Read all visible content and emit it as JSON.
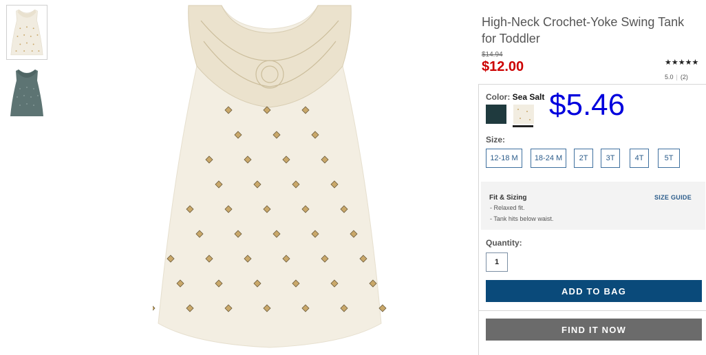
{
  "product": {
    "title": "High-Neck Crochet-Yoke Swing Tank for Toddler",
    "original_price": "$14.94",
    "sale_price": "$12.00",
    "stars": "★★★★★",
    "rating_value": "5.0",
    "rating_count": "(2)"
  },
  "color": {
    "label": "Color:",
    "selected": "Sea Salt",
    "swatches": [
      {
        "name": "dark-teal",
        "hex": "#1f3a3e"
      },
      {
        "name": "sea-salt",
        "hex": "#f2ede1"
      }
    ]
  },
  "overlay_price": "$5.46",
  "size": {
    "label": "Size:",
    "options": [
      "12-18 M",
      "18-24 M",
      "2T",
      "3T",
      "4T",
      "5T"
    ]
  },
  "fit": {
    "title": "Fit & Sizing",
    "size_guide": "SIZE GUIDE",
    "lines": [
      "- Relaxed fit.",
      "- Tank hits below waist."
    ]
  },
  "quantity": {
    "label": "Quantity:",
    "value": "1"
  },
  "buttons": {
    "add_to_bag": "ADD TO BAG",
    "find_it_now": "FIND IT NOW"
  },
  "colors": {
    "sale_red": "#cc0000",
    "primary_blue": "#0a4a7a",
    "find_gray": "#6b6b6b",
    "overlay_blue": "#0000dd"
  }
}
